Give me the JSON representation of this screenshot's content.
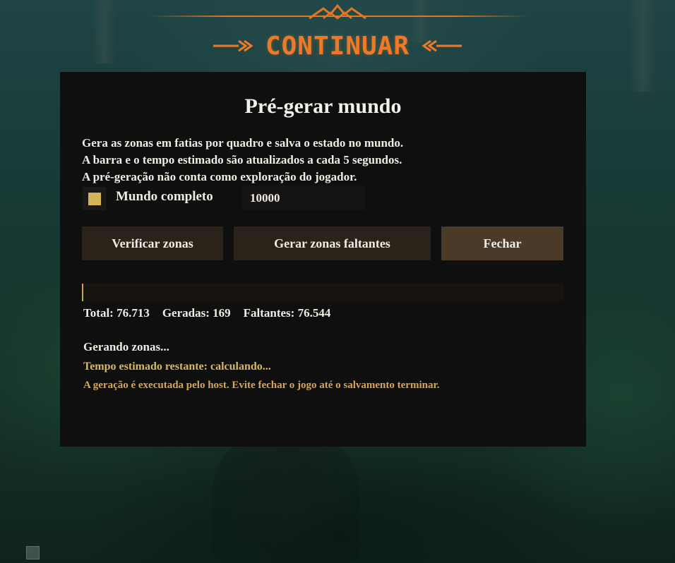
{
  "header": {
    "continue_label": "CONTINUAR"
  },
  "dialog": {
    "title": "Pré-gerar mundo",
    "description": [
      "Gera as zonas em fatias por quadro e salva o estado no mundo.",
      "A barra e o tempo estimado são atualizados a cada 5 segundos.",
      "A pré-geração não conta como exploração do jogador."
    ],
    "full_world": {
      "label": "Mundo completo",
      "checked": true,
      "value": "10000"
    },
    "buttons": {
      "verify": "Verificar zonas",
      "generate_missing": "Gerar zonas faltantes",
      "close": "Fechar"
    },
    "progress": {
      "fraction": 0.0022
    },
    "stats": {
      "total": "Total: 76.713",
      "generated": "Geradas: 169",
      "missing": "Faltantes: 76.544"
    },
    "status": "Gerando zonas...",
    "eta": "Tempo estimado restante: calculando...",
    "warning": "A geração é executada pelo host. Evite fechar o jogo até o salvamento terminar."
  },
  "colors": {
    "accent_orange": "#ee7a28",
    "checkbox_gold": "#d6b55a",
    "progress_gold": "#c7a74f",
    "eta_text": "#d8b862",
    "warning_text": "#d8a552",
    "panel_bg": "#0f0f0f",
    "button_bg": "#2b2219",
    "close_button_bg": "#4b3a28"
  }
}
